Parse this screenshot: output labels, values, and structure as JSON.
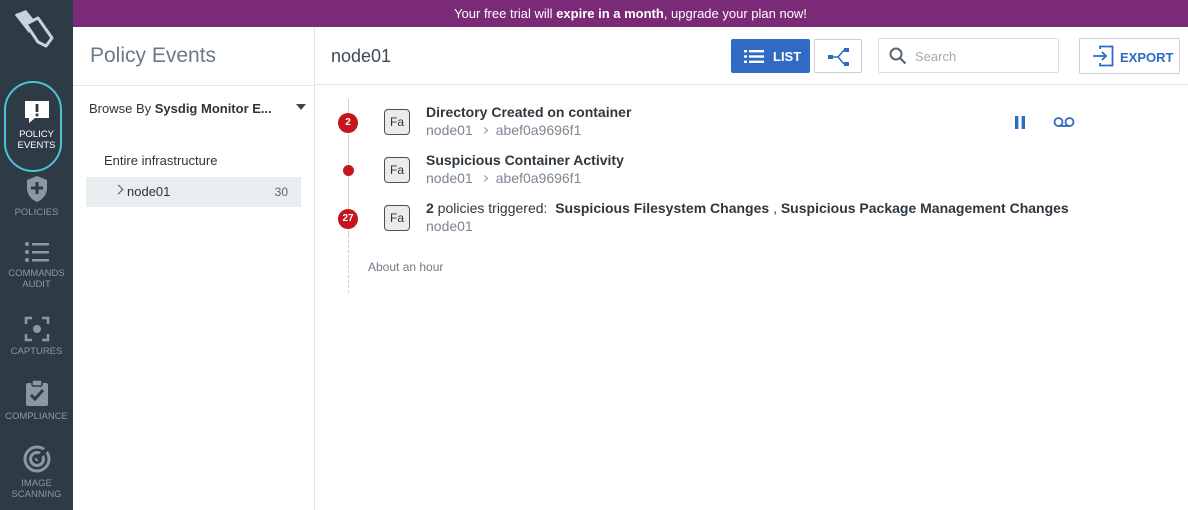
{
  "colors": {
    "nav_bg": "#2e3a46",
    "banner_bg": "#7a2a76",
    "accent": "#2f6bc4",
    "alert": "#c4161c",
    "active_ring": "#4cc3d6"
  },
  "banner": {
    "pre": "Your free trial will ",
    "bold": "expire in a month",
    "post": ", upgrade your plan now!"
  },
  "nav": {
    "logo": "sysdig-logo-icon",
    "items": [
      {
        "line1": "POLICY",
        "line2": "EVENTS",
        "icon": "policy-events-icon",
        "active": true
      },
      {
        "line1": "POLICIES",
        "line2": "",
        "icon": "shield-plus-icon",
        "active": false
      },
      {
        "line1": "COMMANDS",
        "line2": "AUDIT",
        "icon": "list-icon",
        "active": false
      },
      {
        "line1": "CAPTURES",
        "line2": "",
        "icon": "capture-icon",
        "active": false
      },
      {
        "line1": "COMPLIANCE",
        "line2": "",
        "icon": "clipboard-check-icon",
        "active": false
      },
      {
        "line1": "IMAGE",
        "line2": "SCANNING",
        "icon": "scan-icon",
        "active": false
      }
    ]
  },
  "sidebar": {
    "title": "Policy Events",
    "browse_prefix": "Browse By ",
    "browse_value": "Sysdig Monitor E...",
    "tree": {
      "root": "Entire infrastructure",
      "node": {
        "label": "node01",
        "count": "30"
      }
    }
  },
  "main": {
    "title": "node01",
    "list_label": "LIST",
    "export_label": "EXPORT",
    "search_placeholder": "Search"
  },
  "events": [
    {
      "badge": "2",
      "fa": "Fa",
      "title": "Directory Created on container",
      "host": "node01",
      "container": "abef0a9696f1"
    },
    {
      "badge": "",
      "fa": "Fa",
      "title": "Suspicious Container Activity",
      "host": "node01",
      "container": "abef0a9696f1"
    },
    {
      "badge": "27",
      "fa": "Fa",
      "count": "2",
      "triggered_label": " policies triggered:",
      "policy1": "Suspicious Filesystem Changes",
      "policy_sep": ",",
      "policy2": "Suspicious Package Management Changes",
      "host": "node01"
    }
  ],
  "time_label": "About an hour"
}
